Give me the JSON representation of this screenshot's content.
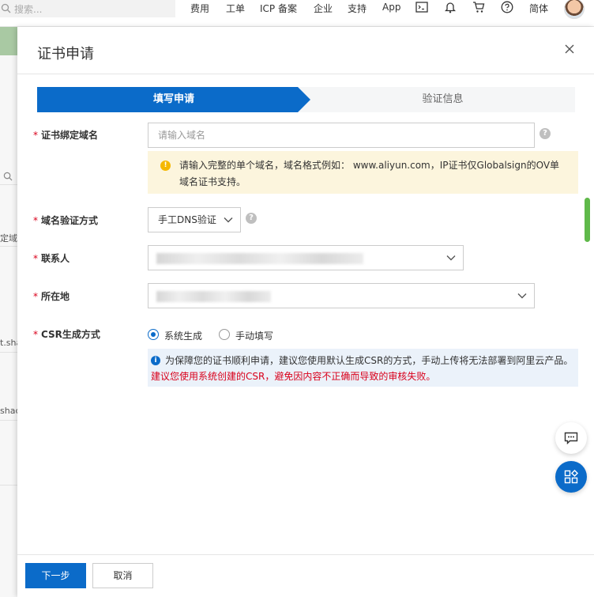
{
  "topbar": {
    "search_placeholder": "搜索...",
    "nav": [
      "费用",
      "工单",
      "ICP 备案",
      "企业",
      "支持",
      "App"
    ],
    "language": "简体",
    "icons": [
      "terminal-icon",
      "bell-icon",
      "cart-icon",
      "help-icon"
    ]
  },
  "background": {
    "rows": [
      "定域名",
      "t.sha",
      "shac"
    ]
  },
  "drawer": {
    "title": "证书申请",
    "steps": [
      {
        "label": "填写申请",
        "active": true
      },
      {
        "label": "验证信息",
        "active": false
      }
    ]
  },
  "form": {
    "domain": {
      "label": "证书绑定域名",
      "placeholder": "请输入域名",
      "tip": "请输入完整的单个域名，域名格式例如： www.aliyun.com，IP证书仅Globalsign的OV单域名证书支持。"
    },
    "verify": {
      "label": "域名验证方式",
      "value": "手工DNS验证"
    },
    "contact": {
      "label": "联系人"
    },
    "location": {
      "label": "所在地"
    },
    "csr": {
      "label": "CSR生成方式",
      "options": [
        {
          "label": "系统生成",
          "checked": true
        },
        {
          "label": "手动填写",
          "checked": false
        }
      ],
      "tip_line1": "为保障您的证书顺利申请，建议您使用默认生成CSR的方式，手动上传将无法部署到阿里云产品。",
      "tip_line2": "建议您使用系统创建的CSR，避免因内容不正确而导致的审核失败。"
    }
  },
  "footer": {
    "next_label": "下一步",
    "cancel_label": "取消"
  },
  "colors": {
    "primary": "#0b6bc9",
    "required": "#d9001b",
    "warning_bg": "#fcf5dd",
    "info_bg": "#ebf2fa"
  }
}
